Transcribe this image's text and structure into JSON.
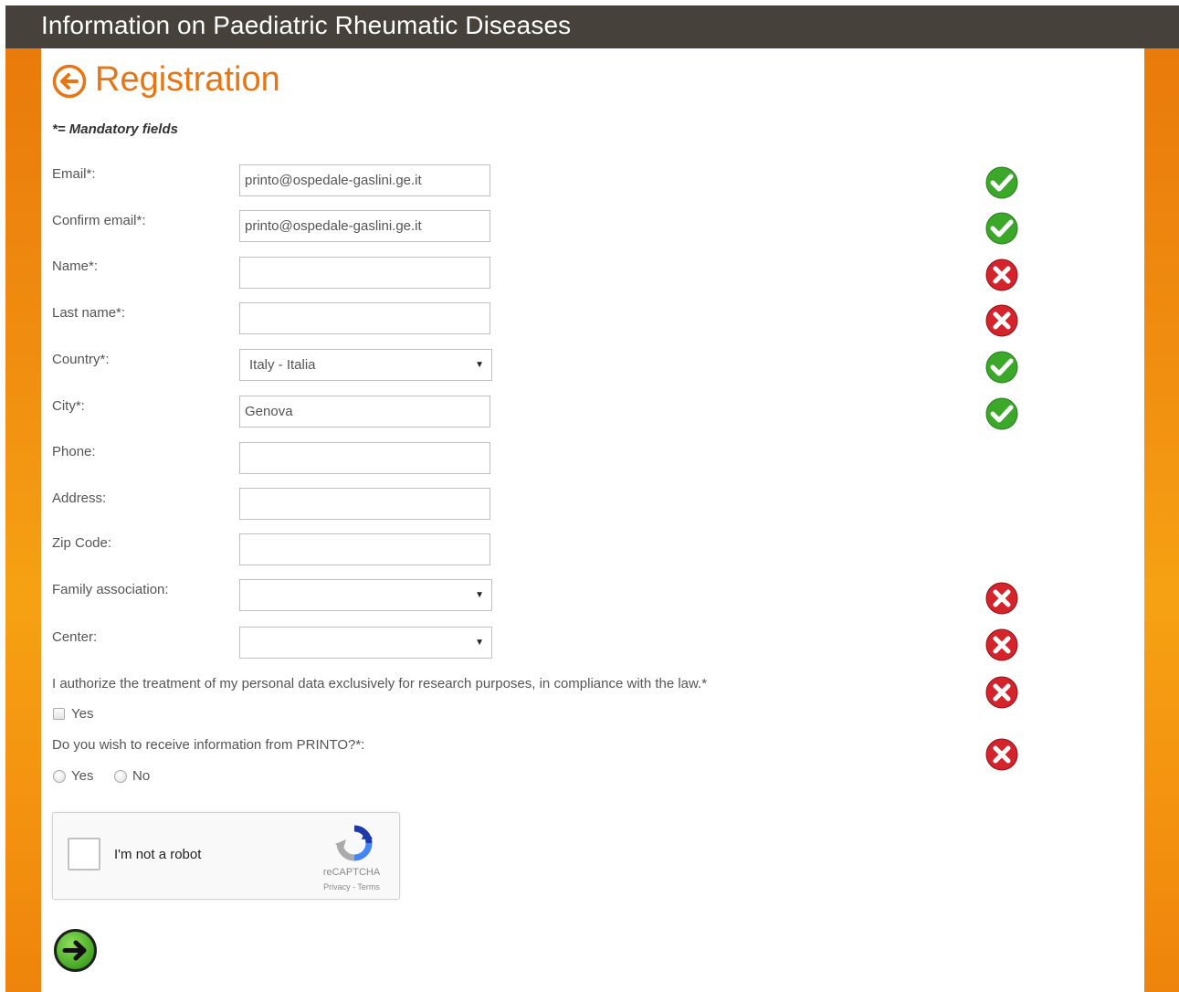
{
  "header": {
    "title": "Information on Paediatric Rheumatic Diseases"
  },
  "page": {
    "title": "Registration",
    "mandatory_note": "*= Mandatory fields"
  },
  "form": {
    "email": {
      "label": "Email*:",
      "value": "printo@ospedale-gaslini.ge.it",
      "status": "valid"
    },
    "confirm_email": {
      "label": "Confirm email*:",
      "value": "printo@ospedale-gaslini.ge.it",
      "status": "valid"
    },
    "name": {
      "label": "Name*:",
      "value": "",
      "status": "invalid"
    },
    "last_name": {
      "label": "Last name*:",
      "value": "",
      "status": "invalid"
    },
    "country": {
      "label": "Country*:",
      "value": "Italy - Italia",
      "status": "valid"
    },
    "city": {
      "label": "City*:",
      "value": "Genova",
      "status": "valid"
    },
    "phone": {
      "label": "Phone:",
      "value": ""
    },
    "address": {
      "label": "Address:",
      "value": ""
    },
    "zip": {
      "label": "Zip Code:",
      "value": ""
    },
    "family_association": {
      "label": "Family association:",
      "value": "",
      "status": "invalid"
    },
    "center": {
      "label": "Center:",
      "value": "",
      "status": "invalid"
    },
    "consent": {
      "label": "I authorize the treatment of my personal data exclusively for research purposes, in compliance with the law.*",
      "option_yes": "Yes",
      "checked": false,
      "status": "invalid"
    },
    "newsletter": {
      "label": "Do you wish to receive information from PRINTO?*:",
      "option_yes": "Yes",
      "option_no": "No",
      "selected": "",
      "status": "invalid"
    }
  },
  "captcha": {
    "label": "I'm not a robot",
    "brand": "reCAPTCHA",
    "terms": "Privacy - Terms"
  },
  "icons": {
    "valid": "check-icon",
    "invalid": "cross-icon",
    "back": "back-arrow-icon",
    "next": "next-arrow-icon"
  },
  "colors": {
    "accent": "#e87514",
    "header_bg": "#46413a",
    "valid": "#3ba82a",
    "invalid": "#d4232b",
    "next": "#47b52b"
  }
}
